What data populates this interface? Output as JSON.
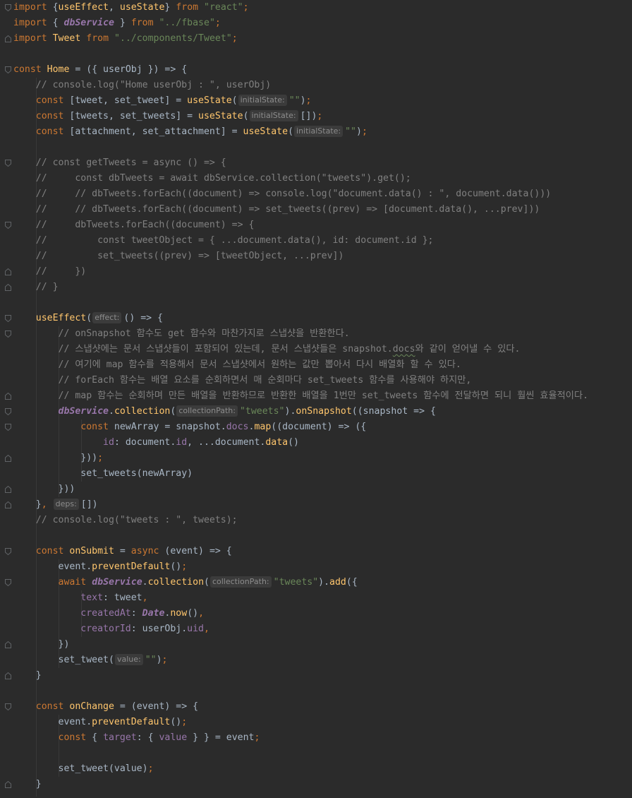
{
  "colors": {
    "background": "#2b2b2b",
    "keyword": "#cc7832",
    "string": "#6a8759",
    "comment": "#808080",
    "function": "#ffc66d",
    "property": "#9876aa",
    "plain": "#a9b7c6",
    "hint_background": "#3b3b3b"
  },
  "icons": {
    "fold_open": "fold-open-icon",
    "fold_close": "fold-close-icon"
  },
  "code": {
    "l1": {
      "kw": "import",
      "p1": " {",
      "fn1": "useEffect",
      "p2": ", ",
      "fn2": "useState",
      "p3": "} ",
      "kw2": "from",
      "p4": " ",
      "str": "\"react\"",
      "kw3": ";"
    },
    "l2": {
      "kw": "import",
      "p1": " { ",
      "glob": "dbService",
      "p2": " } ",
      "kw2": "from",
      "p3": " ",
      "str": "\"../fbase\"",
      "kw3": ";"
    },
    "l3": {
      "kw": "import",
      "p1": " ",
      "fn": "Tweet",
      "p2": " ",
      "kw2": "from",
      "p3": " ",
      "str": "\"../components/Tweet\"",
      "kw3": ";"
    },
    "l5": {
      "kw": "const",
      "p1": " ",
      "fn": "Home",
      "p2": " = ({ userObj }) => {"
    },
    "l6": {
      "cm": "    // console.log(\"Home userObj : \", userObj)"
    },
    "l7": {
      "ind": "    ",
      "kw": "const",
      "p1": " [tweet, set_tweet] = ",
      "fn": "useState",
      "p2": "(",
      "hint": "initialState:",
      "str": "\"\"",
      "p3": ")",
      "kw2": ";"
    },
    "l8": {
      "ind": "    ",
      "kw": "const",
      "p1": " [tweets, set_tweets] = ",
      "fn": "useState",
      "p2": "(",
      "hint": "initialState:",
      "p3": "[])",
      "kw2": ";"
    },
    "l9": {
      "ind": "    ",
      "kw": "const",
      "p1": " [attachment, set_attachment] = ",
      "fn": "useState",
      "p2": "(",
      "hint": "initialState:",
      "str": "\"\"",
      "p3": ")",
      "kw2": ";"
    },
    "l11": {
      "cm": "    // const getTweets = async () => {"
    },
    "l12": {
      "cm": "    //     const dbTweets = await dbService.collection(\"tweets\").get();"
    },
    "l13": {
      "cm": "    //     // dbTweets.forEach((document) => console.log(\"document.data() : \", document.data()))"
    },
    "l14": {
      "cm": "    //     // dbTweets.forEach((document) => set_tweets((prev) => [document.data(), ...prev]))"
    },
    "l15": {
      "cm": "    //     dbTweets.forEach((document) => {"
    },
    "l16": {
      "cm": "    //         const tweetObject = { ...document.data(), id: document.id };"
    },
    "l17": {
      "cm": "    //         set_tweets((prev) => [tweetObject, ...prev])"
    },
    "l18": {
      "cm": "    //     })"
    },
    "l19": {
      "cm": "    // }"
    },
    "l21": {
      "ind": "    ",
      "fn": "useEffect",
      "p1": "(",
      "hint": "effect:",
      "p2": "() => {"
    },
    "l22": {
      "cm": "        // onSnapshot 함수도 get 함수와 마찬가지로 스냅샷을 반환한다."
    },
    "l23": {
      "cm1": "        // 스냅샷에는 문서 스냅샷들이 포함되어 있는데, 문서 스냅샷들은 snapshot.",
      "cm2": "docs",
      "cm3": "와 같이 얻어낼 수 있다."
    },
    "l24": {
      "cm": "        // 여기에 map 함수를 적용해서 문서 스냅샷에서 원하는 값만 뽑아서 다시 배열화 할 수 있다."
    },
    "l25": {
      "cm": "        // forEach 함수는 배열 요소를 순회하면서 매 순회마다 set_tweets 함수를 사용해야 하지만,"
    },
    "l26": {
      "cm": "        // map 함수는 순회하며 만든 배열을 반환하므로 반환한 배열을 1번만 set_tweets 함수에 전달하면 되니 훨씬 효율적이다."
    },
    "l27": {
      "ind": "        ",
      "glob": "dbService",
      "p1": ".",
      "fn": "collection",
      "p2": "(",
      "hint": "collectionPath:",
      "str": "\"tweets\"",
      "p3": ").",
      "fn2": "onSnapshot",
      "p4": "((snapshot => {"
    },
    "l28": {
      "ind": "            ",
      "kw": "const",
      "p1": " newArray = snapshot.",
      "prop": "docs",
      "p2": ".",
      "fn": "map",
      "p3": "((document) => ({"
    },
    "l29": {
      "ind": "                ",
      "prop": "id",
      "p1": ": document.",
      "prop2": "id",
      "p2": ", ...document.",
      "fn": "data",
      "p3": "()"
    },
    "l30": {
      "ind": "            ",
      "p1": "}))",
      "kw": ";"
    },
    "l31": {
      "ind": "            ",
      "p1": "set_tweets(newArray)"
    },
    "l32": {
      "ind": "        ",
      "p1": "}))"
    },
    "l33": {
      "ind": "    ",
      "p1": "}",
      "kw": ",",
      "p2": " ",
      "hint": "deps:",
      "p3": "[])"
    },
    "l34": {
      "cm": "    // console.log(\"tweets : \", tweets);"
    },
    "l36": {
      "ind": "    ",
      "kw": "const",
      "p1": " ",
      "fn": "onSubmit",
      "p2": " = ",
      "kw2": "async",
      "p3": " (event) => {"
    },
    "l37": {
      "ind": "        ",
      "p1": "event.",
      "fn": "preventDefault",
      "p2": "()",
      "kw": ";"
    },
    "l38": {
      "ind": "        ",
      "kw": "await",
      "p1": " ",
      "glob": "dbService",
      "p2": ".",
      "fn": "collection",
      "p3": "(",
      "hint": "collectionPath:",
      "str": "\"tweets\"",
      "p4": ").",
      "fn2": "add",
      "p5": "({"
    },
    "l39": {
      "ind": "            ",
      "prop": "text",
      "p1": ": tweet",
      "kw": ","
    },
    "l40": {
      "ind": "            ",
      "prop": "createdAt",
      "p1": ": ",
      "cls": "Date",
      "p2": ".",
      "fn": "now",
      "p3": "()",
      "kw": ","
    },
    "l41": {
      "ind": "            ",
      "prop": "creatorId",
      "p1": ": userObj.",
      "prop2": "uid",
      "kw": ","
    },
    "l42": {
      "ind": "        ",
      "p1": "})"
    },
    "l43": {
      "ind": "        ",
      "p1": "set_tweet(",
      "hint": "value:",
      "str": "\"\"",
      "p2": ")",
      "kw": ";"
    },
    "l44": {
      "ind": "    ",
      "p1": "}"
    },
    "l46": {
      "ind": "    ",
      "kw": "const",
      "p1": " ",
      "fn": "onChange",
      "p2": " = (event) => {"
    },
    "l47": {
      "ind": "        ",
      "p1": "event.",
      "fn": "preventDefault",
      "p2": "()",
      "kw": ";"
    },
    "l48": {
      "ind": "        ",
      "kw": "const",
      "p1": " { ",
      "prop": "target",
      "p2": ": { ",
      "prop2": "value",
      "p3": " } } = event",
      "kw2": ";"
    },
    "l50": {
      "ind": "        ",
      "p1": "set_tweet(value)",
      "kw": ";"
    },
    "l51": {
      "ind": "    ",
      "p1": "}"
    }
  }
}
